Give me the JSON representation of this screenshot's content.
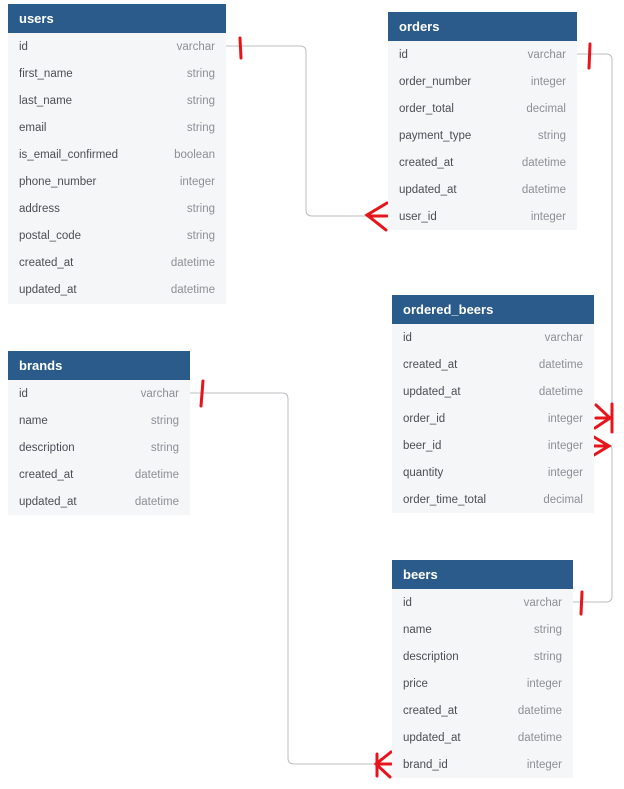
{
  "tables": {
    "users": {
      "name": "users",
      "columns": [
        {
          "name": "id",
          "type": "varchar"
        },
        {
          "name": "first_name",
          "type": "string"
        },
        {
          "name": "last_name",
          "type": "string"
        },
        {
          "name": "email",
          "type": "string"
        },
        {
          "name": "is_email_confirmed",
          "type": "boolean"
        },
        {
          "name": "phone_number",
          "type": "integer"
        },
        {
          "name": "address",
          "type": "string"
        },
        {
          "name": "postal_code",
          "type": "string"
        },
        {
          "name": "created_at",
          "type": "datetime"
        },
        {
          "name": "updated_at",
          "type": "datetime"
        }
      ]
    },
    "orders": {
      "name": "orders",
      "columns": [
        {
          "name": "id",
          "type": "varchar"
        },
        {
          "name": "order_number",
          "type": "integer"
        },
        {
          "name": "order_total",
          "type": "decimal"
        },
        {
          "name": "payment_type",
          "type": "string"
        },
        {
          "name": "created_at",
          "type": "datetime"
        },
        {
          "name": "updated_at",
          "type": "datetime"
        },
        {
          "name": "user_id",
          "type": "integer"
        }
      ]
    },
    "brands": {
      "name": "brands",
      "columns": [
        {
          "name": "id",
          "type": "varchar"
        },
        {
          "name": "name",
          "type": "string"
        },
        {
          "name": "description",
          "type": "string"
        },
        {
          "name": "created_at",
          "type": "datetime"
        },
        {
          "name": "updated_at",
          "type": "datetime"
        }
      ]
    },
    "ordered_beers": {
      "name": "ordered_beers",
      "columns": [
        {
          "name": "id",
          "type": "varchar"
        },
        {
          "name": "created_at",
          "type": "datetime"
        },
        {
          "name": "updated_at",
          "type": "datetime"
        },
        {
          "name": "order_id",
          "type": "integer"
        },
        {
          "name": "beer_id",
          "type": "integer"
        },
        {
          "name": "quantity",
          "type": "integer"
        },
        {
          "name": "order_time_total",
          "type": "decimal"
        }
      ]
    },
    "beers": {
      "name": "beers",
      "columns": [
        {
          "name": "id",
          "type": "varchar"
        },
        {
          "name": "name",
          "type": "string"
        },
        {
          "name": "description",
          "type": "string"
        },
        {
          "name": "price",
          "type": "integer"
        },
        {
          "name": "created_at",
          "type": "datetime"
        },
        {
          "name": "updated_at",
          "type": "datetime"
        },
        {
          "name": "brand_id",
          "type": "integer"
        }
      ]
    }
  },
  "relationships": [
    {
      "from": "users.id",
      "to": "orders.user_id",
      "cardinality": "one-to-many"
    },
    {
      "from": "brands.id",
      "to": "beers.brand_id",
      "cardinality": "one-to-many"
    },
    {
      "from": "orders.id",
      "to": "ordered_beers.order_id",
      "cardinality": "one-to-many"
    },
    {
      "from": "beers.id",
      "to": "ordered_beers.beer_id",
      "cardinality": "one-to-many"
    }
  ],
  "colors": {
    "header": "#2b5b8a",
    "body": "#f5f6f7",
    "connector": "#b8bcc0",
    "marker": "#e8141b"
  }
}
